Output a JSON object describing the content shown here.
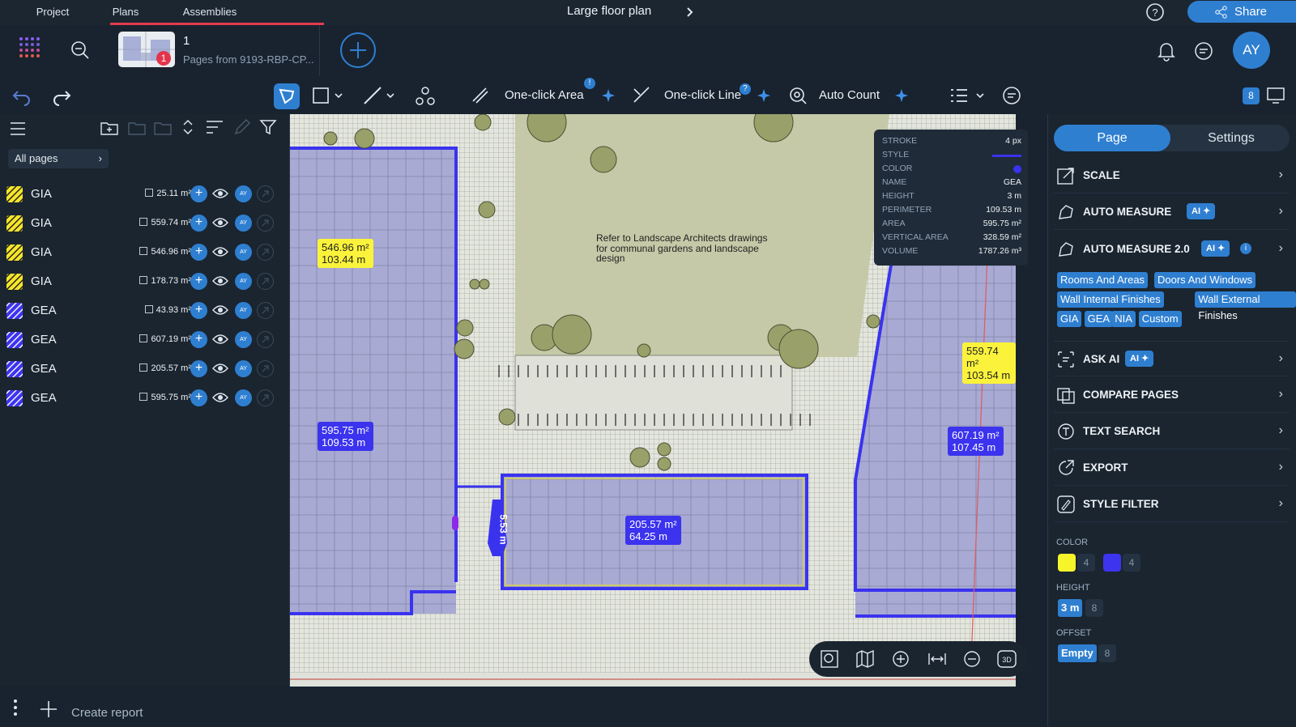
{
  "top_tabs": {
    "project": "Project",
    "plans": "Plans",
    "assemblies": "Assemblies"
  },
  "document": {
    "title": "Large floor plan",
    "share_label": "Share"
  },
  "page": {
    "number": "1",
    "subtitle": "Pages from 9193-RBP-CP...",
    "badge": "1"
  },
  "user": {
    "initials": "AY"
  },
  "toolbar": {
    "one_click_area": "One-click Area",
    "one_click_line": "One-click Line",
    "auto_count": "Auto Count",
    "count_badge": "8"
  },
  "left_panel": {
    "filter_label": "All pages",
    "rows": [
      {
        "name": "GIA",
        "value": "25.11 m²",
        "color": "#f6e52a",
        "avatar": "AY"
      },
      {
        "name": "GIA",
        "value": "559.74 m²",
        "color": "#f6e52a",
        "avatar": "AY"
      },
      {
        "name": "GIA",
        "value": "546.96 m²",
        "color": "#f6e52a",
        "avatar": "AY"
      },
      {
        "name": "GIA",
        "value": "178.73 m²",
        "color": "#f6e52a",
        "avatar": "AY"
      },
      {
        "name": "GEA",
        "value": "43.93 m²",
        "color": "#3d34f0",
        "avatar": "AY"
      },
      {
        "name": "GEA",
        "value": "607.19 m²",
        "color": "#3d34f0",
        "avatar": "AY"
      },
      {
        "name": "GEA",
        "value": "205.57 m²",
        "color": "#3d34f0",
        "avatar": "AY"
      },
      {
        "name": "GEA",
        "value": "595.75 m²",
        "color": "#3d34f0",
        "avatar": "AY"
      }
    ]
  },
  "bottom": {
    "create_report": "Create report"
  },
  "canvas": {
    "note": [
      "Refer to Landscape Architects drawings",
      "for communal gardens and landscape",
      "design"
    ],
    "labels": [
      {
        "area": "546.96 m²",
        "perimeter": "103.44 m"
      },
      {
        "area": "595.75 m²",
        "perimeter": "109.53 m"
      },
      {
        "area": "205.57 m²",
        "perimeter": "64.25 m"
      },
      {
        "area": "559.74 m²",
        "perimeter": "103.54 m"
      },
      {
        "area": "607.19 m²",
        "perimeter": "107.45 m"
      }
    ],
    "dimension": "5.53 m"
  },
  "properties": {
    "stroke_k": "STROKE",
    "stroke_v": "4 px",
    "style_k": "STYLE",
    "color_k": "COLOR",
    "name_k": "NAME",
    "name_v": "GEA",
    "height_k": "HEIGHT",
    "height_v": "3 m",
    "perimeter_k": "PERIMETER",
    "perimeter_v": "109.53 m",
    "area_k": "AREA",
    "area_v": "595.75 m²",
    "varea_k": "VERTICAL AREA",
    "varea_v": "328.59 m²",
    "volume_k": "VOLUME",
    "volume_v": "1787.26 m³"
  },
  "right_panel": {
    "tab_page": "Page",
    "tab_settings": "Settings",
    "scale": "SCALE",
    "auto_measure": "AUTO MEASURE",
    "auto_measure_2": "AUTO MEASURE 2.0",
    "ai_badge": "AI",
    "chips": [
      "Rooms And Areas",
      "Doors And Windows",
      "Wall Internal Finishes",
      "Wall External Finishes",
      "GIA",
      "GEA",
      "NIA",
      "Custom"
    ],
    "ask_ai": "ASK AI",
    "compare_pages": "COMPARE PAGES",
    "text_search": "TEXT SEARCH",
    "export": "EXPORT",
    "style_filter": "STYLE FILTER",
    "color_heading": "COLOR",
    "color_yellow_count": "4",
    "color_blue_count": "4",
    "height_heading": "HEIGHT",
    "height_value": "3 m",
    "height_count": "8",
    "offset_heading": "OFFSET",
    "offset_value": "Empty",
    "offset_count": "8"
  }
}
